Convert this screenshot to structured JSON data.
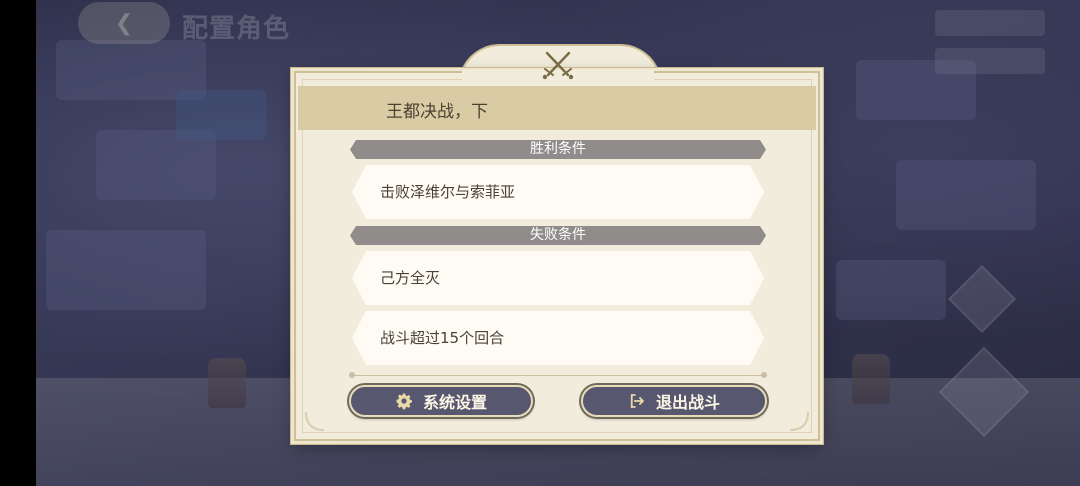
{
  "hud": {
    "back_icon": "chevron-left-icon",
    "title": "配置角色"
  },
  "dialog": {
    "crest_icon": "crossed-swords-icon",
    "stage_title": "王都决战，下",
    "victory": {
      "header": "胜利条件",
      "conditions": [
        "击败泽维尔与索菲亚"
      ]
    },
    "defeat": {
      "header": "失败条件",
      "conditions": [
        "己方全灭",
        "战斗超过15个回合"
      ]
    },
    "buttons": {
      "settings_label": "系统设置",
      "settings_icon": "gear-icon",
      "exit_label": "退出战斗",
      "exit_icon": "exit-icon"
    }
  },
  "colors": {
    "button_bg": "#575870",
    "section_band": "#8f8c8b",
    "title_band": "#d9cca4",
    "panel": "#f2ecdc"
  }
}
